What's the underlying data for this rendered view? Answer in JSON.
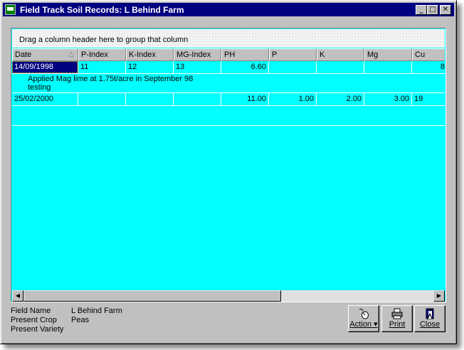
{
  "window": {
    "title": "Field Track Soil Records: L Behind Farm",
    "controls": [
      "_",
      "□",
      "✕"
    ]
  },
  "grid": {
    "group_hint": "Drag a column header here to group that column",
    "sort_indicator": "△",
    "columns": [
      "Date",
      "P-Index",
      "K-Index",
      "MG-Index",
      "PH",
      "P",
      "K",
      "Mg",
      "Cu"
    ],
    "rows": [
      {
        "cells": [
          "14/09/1998",
          "11",
          "12",
          "13",
          "6.60",
          "",
          "",
          "",
          "8"
        ],
        "note": [
          "Applied Mag lime at 1.75t/acre in September 98",
          "testing"
        ]
      },
      {
        "cells": [
          "25/02/2000",
          "",
          "",
          "",
          "11.00",
          "1.00",
          "2.00",
          "3.00",
          "19"
        ],
        "note": []
      }
    ]
  },
  "info": {
    "field_name_label": "Field Name",
    "field_name_value": "L Behind Farm",
    "present_crop_label": "Present Crop",
    "present_crop_value": "Peas",
    "present_variety_label": "Present Variety",
    "present_variety_value": ""
  },
  "buttons": {
    "action_label": "Action",
    "print_label": "Print",
    "close_label": "Close"
  },
  "icons": {
    "app": "app-icon",
    "action": "mouse-icon",
    "print": "printer-icon",
    "close": "exit-icon"
  }
}
